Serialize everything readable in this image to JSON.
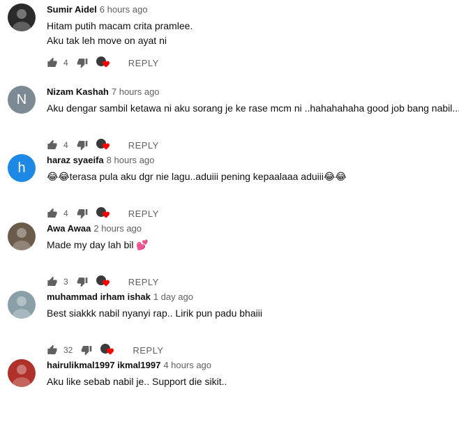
{
  "comments": [
    {
      "author": "Sumir Aidel",
      "time": "6 hours ago",
      "lines": [
        "Hitam putih macam crita pramlee.",
        "Aku tak leh move on ayat ni"
      ],
      "likes": "4",
      "reply_label": "REPLY",
      "avatar_kind": "image",
      "avatar_color": "#2a2a2a"
    },
    {
      "author": "Nizam Kashah",
      "time": "7 hours ago",
      "lines": [
        "Aku dengar sambil ketawa ni aku sorang je ke rase mcm ni ..hahahahaha good job bang nabil..."
      ],
      "likes": "4",
      "reply_label": "REPLY",
      "avatar_kind": "letter",
      "avatar_letter": "N",
      "avatar_color": "#7c8a94"
    },
    {
      "author": "haraz syaeifa",
      "time": "8 hours ago",
      "lines": [
        "😂😂terasa pula aku dgr nie lagu..aduiii pening kepaalaaa aduiii😂😂"
      ],
      "likes": "4",
      "reply_label": "REPLY",
      "avatar_kind": "letter",
      "avatar_letter": "h",
      "avatar_color": "#1e88e5"
    },
    {
      "author": "Awa Awaa",
      "time": "2 hours ago",
      "lines": [
        "Made my day lah bil 💕"
      ],
      "likes": "3",
      "reply_label": "REPLY",
      "avatar_kind": "image",
      "avatar_color": "#6b5b4b"
    },
    {
      "author": "muhammad irham ishak",
      "time": "1 day ago",
      "lines": [
        "Best siakkk nabil nyanyi rap.. Lirik pun padu bhaiii"
      ],
      "likes": "32",
      "reply_label": "REPLY",
      "avatar_kind": "image",
      "avatar_color": "#8aa0a8"
    },
    {
      "author": "hairulikmal1997 ikmal1997",
      "time": "4 hours ago",
      "lines": [
        "Aku like sebab nabil je.. Support die sikit.."
      ],
      "avatar_kind": "image",
      "avatar_color": "#b0302a"
    }
  ],
  "icons": {
    "like": "thumb-up-icon",
    "dislike": "thumb-down-icon",
    "creator_heart": "creator-heart-icon"
  },
  "colors": {
    "heart": "#ff0000",
    "meta_gray": "#606060"
  }
}
